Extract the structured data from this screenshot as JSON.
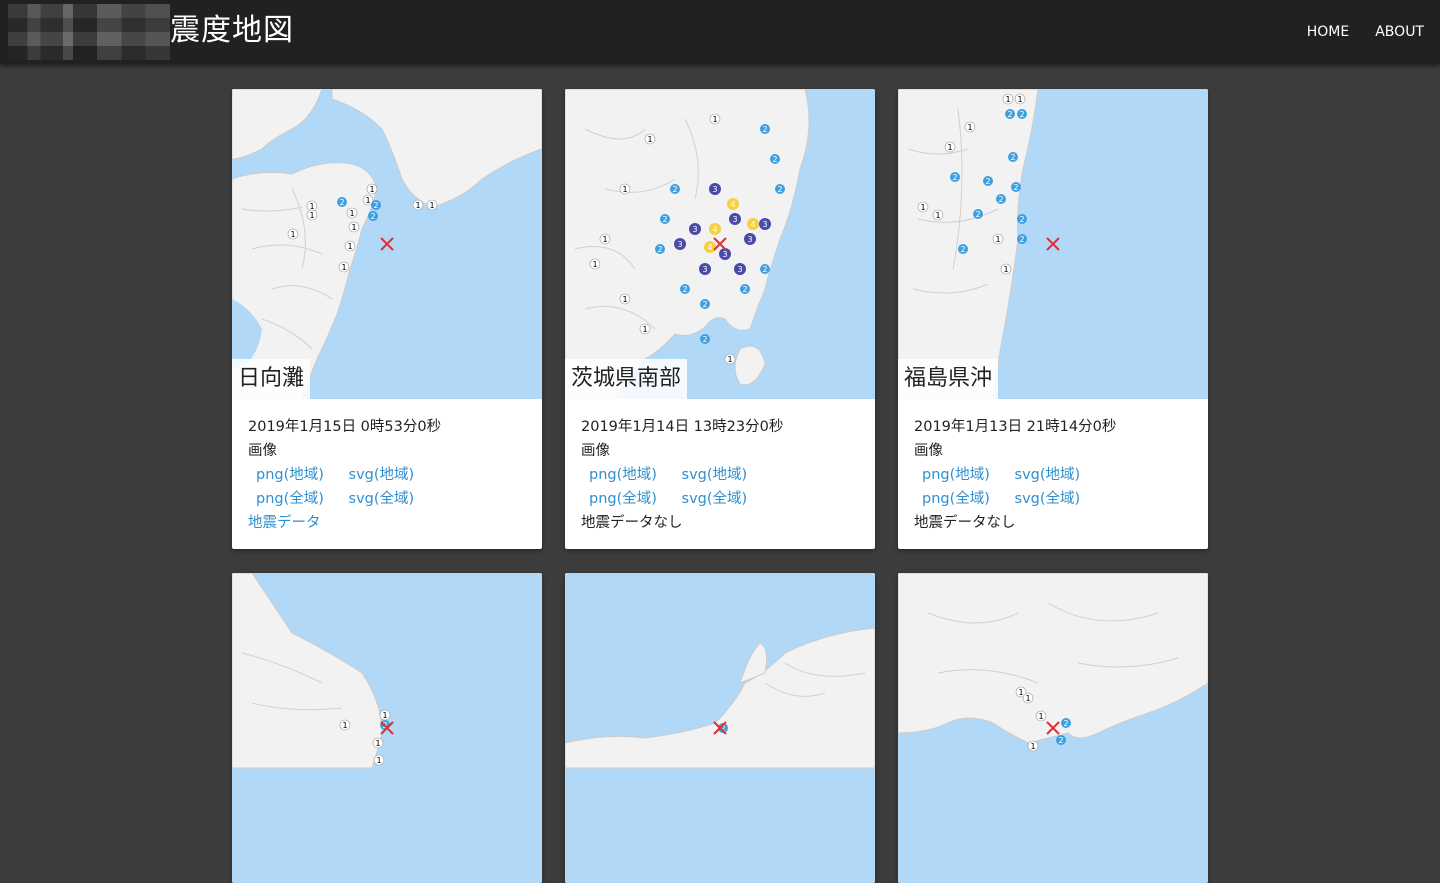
{
  "header": {
    "title": "震度地図",
    "nav": [
      "HOME",
      "ABOUT"
    ]
  },
  "colors": {
    "sea": "#b1d8f7",
    "land": "#f2f2f2",
    "intensity1": "#ffffff",
    "intensity2": "#3fa0e0",
    "intensity3": "#4a4aa8",
    "intensity4": "#f5d040",
    "epicenter": "#e03030",
    "link": "#2f8fd0"
  },
  "cards": [
    {
      "title": "日向灘",
      "datetime": "2019年1月15日 0時53分0秒",
      "images_label": "画像",
      "links": [
        "png(地域)",
        "svg(地域)",
        "png(全域)",
        "svg(全域)"
      ],
      "quake_data": "地震データ",
      "quake_data_is_link": true
    },
    {
      "title": "茨城県南部",
      "datetime": "2019年1月14日 13時23分0秒",
      "images_label": "画像",
      "links": [
        "png(地域)",
        "svg(地域)",
        "png(全域)",
        "svg(全域)"
      ],
      "quake_data": "地震データなし",
      "quake_data_is_link": false
    },
    {
      "title": "福島県沖",
      "datetime": "2019年1月13日 21時14分0秒",
      "images_label": "画像",
      "links": [
        "png(地域)",
        "svg(地域)",
        "png(全域)",
        "svg(全域)"
      ],
      "quake_data": "地震データなし",
      "quake_data_is_link": false
    },
    {
      "title": ""
    },
    {
      "title": ""
    },
    {
      "title": ""
    }
  ]
}
